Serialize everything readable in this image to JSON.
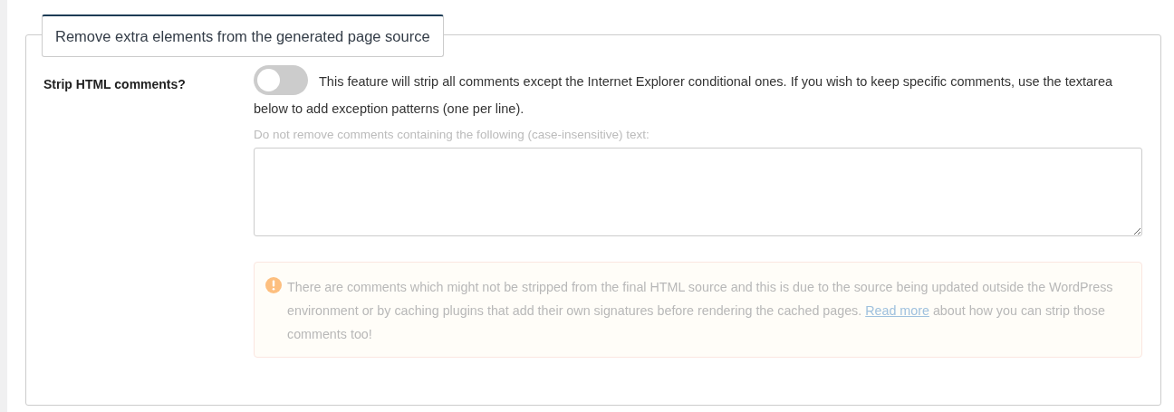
{
  "section": {
    "title": "Remove extra elements from the generated page source"
  },
  "setting": {
    "label": "Strip HTML comments?",
    "toggle": {
      "checked": false
    },
    "description": "This feature will strip all comments except the Internet Explorer conditional ones. If you wish to keep specific comments, use the textarea below to add exception patterns (one per line)."
  },
  "exceptions": {
    "disabled": true,
    "label": "Do not remove comments containing the following (case-insensitive) text:",
    "notice": {
      "text_before": "There are comments which might not be stripped from the final HTML source and this is due to the source being updated outside the WordPress environment or by caching plugins that add their own signatures before rendering the cached pages.",
      "link": "Read more",
      "text_after": "about how you can strip those comments too!"
    }
  }
}
